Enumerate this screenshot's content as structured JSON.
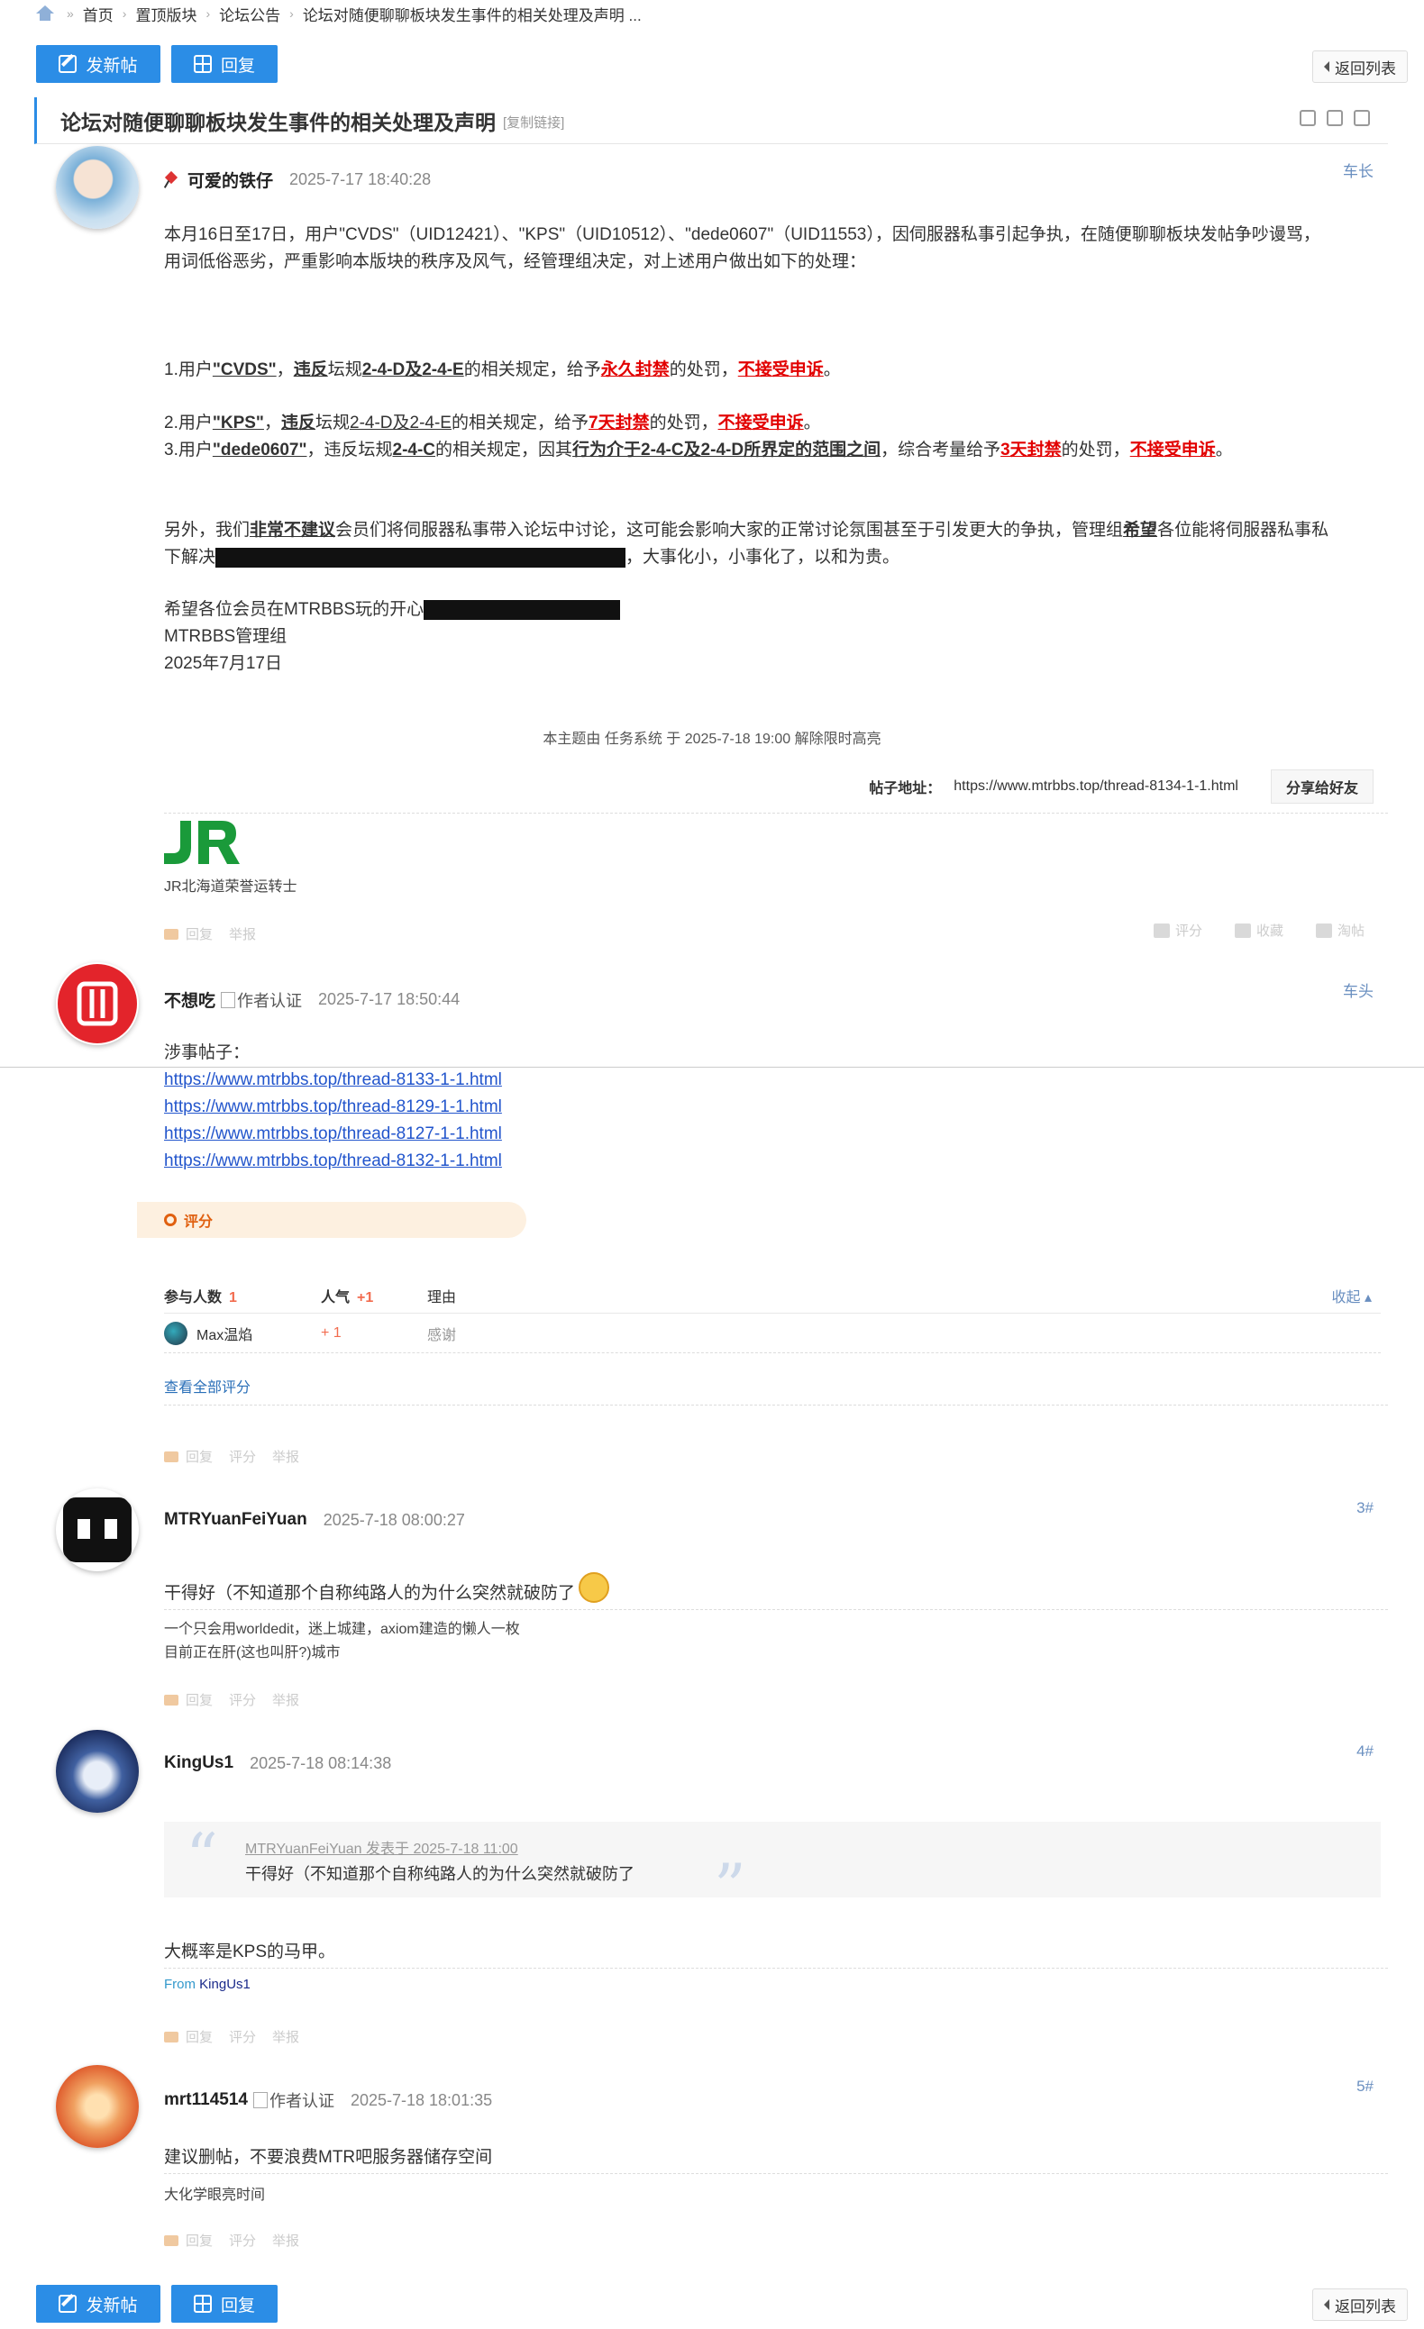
{
  "breadcrumb": {
    "items": [
      "首页",
      "置顶版块",
      "论坛公告",
      "论坛对随便聊聊板块发生事件的相关处理及声明 ..."
    ]
  },
  "toolbar": {
    "new_post": "发新帖",
    "reply": "回复",
    "back_to_list": "返回列表"
  },
  "thread": {
    "title": "论坛对随便聊聊板块发生事件的相关处理及声明",
    "copy_link": "[复制链接]"
  },
  "posts": [
    {
      "author": "可爱的铁仔",
      "time": "2025-7-17 18:40:28",
      "floor": "车长",
      "intro1": "本月16日至17日，用户\"CVDS\"（UID12421）、\"KPS\"（UID10512）、\"dede0607\"（UID11553），因伺服器私事引起争执，在随便聊聊板块发帖争吵谩骂，",
      "intro2": "用词低俗恶劣，严重影响本版块的秩序及风气，经管理组决定，对上述用户做出如下的处理：",
      "item1": {
        "a": "1.用户",
        "user": "\"CVDS\"",
        "b": "，",
        "viol": "违反",
        "c": "坛规",
        "rule": "2-4-D及2-4-E",
        "d": "的相关规定，给予",
        "ban": "永久封禁",
        "e": "的处罚，",
        "appeal": "不接受申诉",
        "f": "。"
      },
      "item2": {
        "a": "2.用户",
        "user": "\"KPS\"",
        "b": "，",
        "viol": "违反",
        "c": "坛规",
        "rule": "2-4-D及2-4-E",
        "d": "的相关规定，给予",
        "ban": "7天封禁",
        "e": "的处罚，",
        "appeal": "不接受申诉",
        "f": "。"
      },
      "item3": {
        "a": "3.用户",
        "user": "\"dede0607\"",
        "b": "，违反坛规",
        "rule": "2-4-C",
        "c": "的相关规定，因其",
        "reason": "行为介于2-4-C及2-4-D所界定的范围之间",
        "d": "，综合考量给予",
        "ban": "3天封禁",
        "e": "的处罚，",
        "appeal": "不接受申诉",
        "f": "。"
      },
      "para2": {
        "a": "另外，我们",
        "strong": "非常不建议",
        "b": "会员们将伺服器私事带入论坛中讨论，这可能会影响大家的正常讨论氛围甚至于引发更大的争执，管理组",
        "hope": "希望",
        "c": "各位能将伺服器私事私",
        "d": "下解决",
        "e": "，大事化小，小事化了，以和为贵。"
      },
      "closing1": "希望各位会员在MTRBBS玩的开心",
      "closing2": "MTRBBS管理组",
      "closing3": "2025年7月17日",
      "mod_note": "本主题由 任务系统 于 2025-7-18 19:00 解除限时高亮",
      "thread_addr_label": "帖子地址：",
      "thread_addr": "https://www.mtrbbs.top/thread-8134-1-1.html",
      "share": "分享给好友",
      "sig_logo": "JR",
      "sig_text": "JR北海道荣誉运转士",
      "actions": [
        "回复",
        "举报"
      ],
      "actions_right": [
        "评分",
        "收藏",
        "淘帖"
      ]
    },
    {
      "author": "不想吃",
      "badge": "作者认证",
      "time": "2025-7-17 18:50:44",
      "floor": "车头",
      "label": "涉事帖子：",
      "links": [
        "https://www.mtrbbs.top/thread-8133-1-1.html",
        "https://www.mtrbbs.top/thread-8129-1-1.html",
        "https://www.mtrbbs.top/thread-8127-1-1.html",
        "https://www.mtrbbs.top/thread-8132-1-1.html"
      ],
      "rate_title": "评分",
      "rate_header": {
        "participants": "参与人数",
        "participants_count": "1",
        "popularity": "人气",
        "popularity_val": "+1",
        "reason": "理由",
        "collapse": "收起"
      },
      "rate_rows": [
        {
          "user": "Max温焰",
          "val": "+ 1",
          "reason": "感谢"
        }
      ],
      "view_all": "查看全部评分",
      "actions": [
        "回复",
        "评分",
        "举报"
      ]
    },
    {
      "author": "MTRYuanFeiYuan",
      "time": "2025-7-18 08:00:27",
      "floor": "3#",
      "text": "干得好（不知道那个自称纯路人的为什么突然就破防了",
      "sig1": "一个只会用worldedit，迷上城建，axiom建造的懒人一枚",
      "sig2": "目前正在肝(这也叫肝?)城市",
      "actions": [
        "回复",
        "评分",
        "举报"
      ]
    },
    {
      "author": "KingUs1",
      "time": "2025-7-18 08:14:38",
      "floor": "4#",
      "quote_meta": "MTRYuanFeiYuan 发表于 2025-7-18 11:00",
      "quote_text": "干得好（不知道那个自称纯路人的为什么突然就破防了",
      "text": "大概率是KPS的马甲。",
      "from_label": "From",
      "from_name": "KingUs1",
      "actions": [
        "回复",
        "评分",
        "举报"
      ]
    },
    {
      "author": "mrt114514",
      "badge": "作者认证",
      "time": "2025-7-18 18:01:35",
      "floor": "5#",
      "text": "建议删帖，不要浪费MTR吧服务器储存空间",
      "sig": "大化学眼亮时间",
      "actions": [
        "回复",
        "评分",
        "举报"
      ]
    }
  ],
  "colors": {
    "accent": "#2b8de6",
    "red": "#e20000",
    "link": "#2255cc",
    "rate_orange": "#e06010"
  }
}
